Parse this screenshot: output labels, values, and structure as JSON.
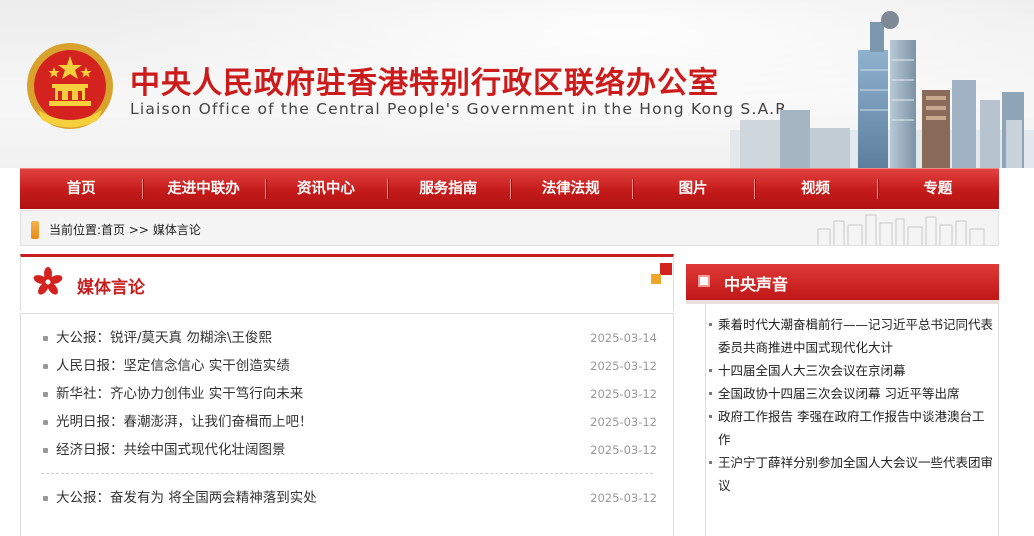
{
  "header": {
    "title_cn": "中央人民政府驻香港特别行政区联络办公室",
    "title_en": "Liaison Office of the Central People's Government in the Hong Kong S.A.R.",
    "emblem_icon": "national-emblem-icon",
    "colors": {
      "brand_red": "#cc1b1b",
      "nav_red": "#c41a1a",
      "accent_orange": "#e8891a"
    }
  },
  "nav": {
    "items": [
      {
        "label": "首页"
      },
      {
        "label": "走进中联办"
      },
      {
        "label": "资讯中心"
      },
      {
        "label": "服务指南"
      },
      {
        "label": "法律法规"
      },
      {
        "label": "图片"
      },
      {
        "label": "视频"
      },
      {
        "label": "专题"
      }
    ]
  },
  "breadcrumb": {
    "prefix": "当前位置:",
    "home": "首页",
    "separator": " >> ",
    "current": "媒体言论"
  },
  "main": {
    "title": "媒体言论",
    "news_group_1": [
      {
        "title": "大公报：锐评/莫天真  勿糊涂\\王俊熙",
        "date": "2025-03-14"
      },
      {
        "title": "人民日报：坚定信念信心  实干创造实绩",
        "date": "2025-03-12"
      },
      {
        "title": "新华社：齐心协力创伟业  实干笃行向未来",
        "date": "2025-03-12"
      },
      {
        "title": "光明日报：春潮澎湃，让我们奋楫而上吧！",
        "date": "2025-03-12"
      },
      {
        "title": "经济日报：共绘中国式现代化壮阔图景",
        "date": "2025-03-12"
      }
    ],
    "news_group_2": [
      {
        "title": "大公报：奋发有为  将全国两会精神落到实处",
        "date": "2025-03-12"
      }
    ]
  },
  "sidebar": {
    "title": "中央声音",
    "items": [
      {
        "text": "乘着时代大潮奋楫前行——记习近平总书记同代表委员共商推进中国式现代化大计"
      },
      {
        "text": "十四届全国人大三次会议在京闭幕"
      },
      {
        "text": "全国政协十四届三次会议闭幕  习近平等出席"
      },
      {
        "text": "政府工作报告  李强在政府工作报告中谈港澳台工作"
      },
      {
        "text": "王沪宁丁薛祥分别参加全国人大会议一些代表团审议"
      }
    ]
  }
}
